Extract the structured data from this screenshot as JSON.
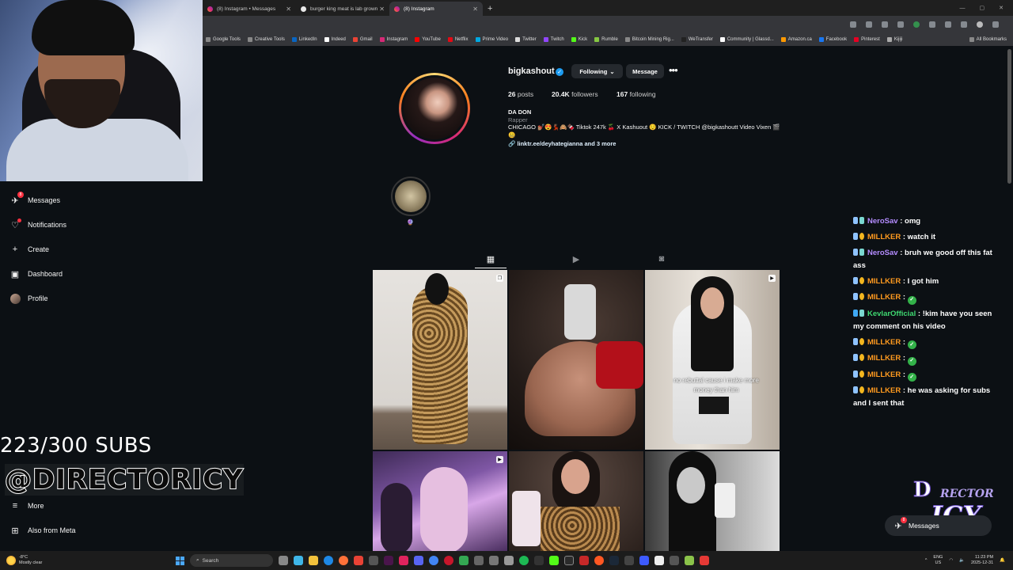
{
  "browser": {
    "tabs": [
      {
        "title": "(8) Instagram • Messages",
        "active": false
      },
      {
        "title": "burger king meat is lab grown",
        "active": false
      },
      {
        "title": "(8) Instagram",
        "active": true
      }
    ],
    "new_tab": "+",
    "bookmarks": [
      "Google Tools",
      "Creative Tools",
      "LinkedIn",
      "Indeed",
      "Gmail",
      "Instagram",
      "YouTube",
      "Netflix",
      "Prime Video",
      "Twitter",
      "Twitch",
      "Kick",
      "Rumble",
      "Bitcoin Mining Rig...",
      "WeTransfer",
      "Community | Glassd...",
      "Amazon.ca",
      "Facebook",
      "Pinterest",
      "Kijiji"
    ],
    "all_bookmarks": "All Bookmarks"
  },
  "nav": {
    "messages": "Messages",
    "messages_badge": "8",
    "notifications": "Notifications",
    "create": "Create",
    "dashboard": "Dashboard",
    "profile": "Profile",
    "more": "More",
    "also_from_meta": "Also from Meta"
  },
  "overlay": {
    "sub_counter": "223/300 SUBS",
    "handle": "@DIRECTORICY"
  },
  "profile": {
    "username": "bigkashout",
    "following_btn": "Following",
    "message_btn": "Message",
    "posts_count": "26",
    "posts_label": "posts",
    "followers_count": "20.4K",
    "followers_label": "followers",
    "following_count": "167",
    "following_label": "following",
    "display_name": "DA DON",
    "category": "Rapper",
    "bio": "CHICAGO 💅🏽😍💃🏽🙈🍫 Tiktok 247k 🍒 X Kashuout 😌 KICK / TWITCH @bigkashoutt Video Vixen 🎬🤐",
    "link": "linktr.ee/deyhategianna and 3 more",
    "highlight_label": "🔮"
  },
  "posts": {
    "caption_overlay": "no rebuttal cause i make more money than him"
  },
  "chat": [
    {
      "user": "NeroSav",
      "color": "#b48cff",
      "text": "omg"
    },
    {
      "user": "MILLKER",
      "color": "#ff9a1f",
      "text": "watch it"
    },
    {
      "user": "NeroSav",
      "color": "#b48cff",
      "text": "bruh we good off this fat ass"
    },
    {
      "user": "MILLKER",
      "color": "#ff9a1f",
      "text": "I got him"
    },
    {
      "user": "MILLKER",
      "color": "#ff9a1f",
      "text": "",
      "check": true
    },
    {
      "user": "KevlarOfficial",
      "color": "#3fd971",
      "text": "!kim have you seen my comment on his video"
    },
    {
      "user": "MILLKER",
      "color": "#ff9a1f",
      "text": "",
      "check": true
    },
    {
      "user": "MILLKER",
      "color": "#ff9a1f",
      "text": "",
      "check": true
    },
    {
      "user": "MILLKER",
      "color": "#ff9a1f",
      "text": "",
      "check": true
    },
    {
      "user": "MILLKER",
      "color": "#ff9a1f",
      "text": "he was asking for subs and I sent that"
    }
  ],
  "logo": {
    "part1": "D",
    "part2": "RECTOR",
    "part3": "ICY"
  },
  "msg_pill": {
    "label": "Messages",
    "badge": "8"
  },
  "taskbar": {
    "temp": "-8°C",
    "weather": "Mostly clear",
    "search": "Search",
    "lang1": "ENG",
    "lang2": "US",
    "time": "11:23 PM",
    "date": "2025-12-31"
  }
}
